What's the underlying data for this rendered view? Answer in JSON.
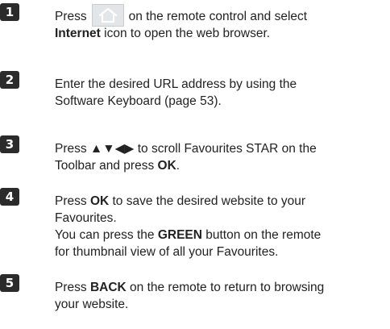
{
  "steps": [
    {
      "number": "1",
      "icon": "home-icon",
      "line1_pre": "Press",
      "line1_post": "on the remote control and select",
      "line2_bold": "Internet",
      "line2_rest": " icon to open the web browser."
    },
    {
      "number": "2",
      "line1": "Enter the desired URL address by using the",
      "line2": "Software Keyboard (page 53)."
    },
    {
      "number": "3",
      "line1_pre": "Press ▲▼◀▶ to scroll Favourites STAR on the",
      "line2_pre": "Toolbar and press ",
      "line2_bold": "OK",
      "line2_post": "."
    },
    {
      "number": "4",
      "line1_pre": "Press ",
      "line1_bold": "OK",
      "line1_post": " to save the desired website to your",
      "line2": "Favourites.",
      "line3_pre": "You can press the ",
      "line3_bold": "GREEN",
      "line3_post": " button on the remote",
      "line4": "for thumbnail view of all your Favourites."
    },
    {
      "number": "5",
      "line1_pre": "Press ",
      "line1_bold": "BACK",
      "line1_post": " on the remote to return to browsing",
      "line2": "your website."
    }
  ]
}
